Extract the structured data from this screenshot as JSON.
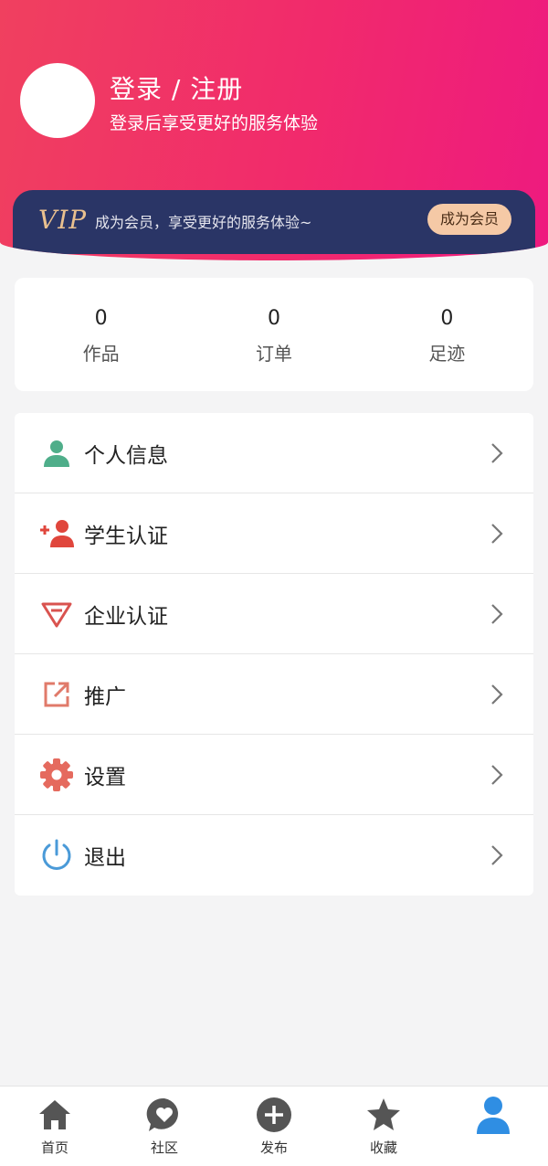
{
  "header": {
    "title": "登录 / 注册",
    "subtitle": "登录后享受更好的服务体验"
  },
  "vip": {
    "logo": "VIP",
    "text": "成为会员，享受更好的服务体验~",
    "button": "成为会员"
  },
  "stats": [
    {
      "value": "0",
      "label": "作品"
    },
    {
      "value": "0",
      "label": "订单"
    },
    {
      "value": "0",
      "label": "足迹"
    }
  ],
  "menu": [
    {
      "label": "个人信息",
      "icon": "person-icon"
    },
    {
      "label": "学生认证",
      "icon": "add-user-icon"
    },
    {
      "label": "企业认证",
      "icon": "diamond-icon"
    },
    {
      "label": "推广",
      "icon": "share-icon"
    },
    {
      "label": "设置",
      "icon": "gear-icon"
    },
    {
      "label": "退出",
      "icon": "power-icon"
    }
  ],
  "tabs": [
    {
      "label": "首页",
      "icon": "home-icon"
    },
    {
      "label": "社区",
      "icon": "chat-heart-icon"
    },
    {
      "label": "发布",
      "icon": "plus-circle-icon"
    },
    {
      "label": "收藏",
      "icon": "star-icon"
    },
    {
      "label": "",
      "icon": "user-icon"
    }
  ],
  "colors": {
    "header_gradient_start": "#f0405f",
    "header_gradient_end": "#ee1a7f",
    "vip_bar": "#2a3566",
    "vip_gold": "#e9c08f",
    "active_tab": "#2f8ee3"
  }
}
